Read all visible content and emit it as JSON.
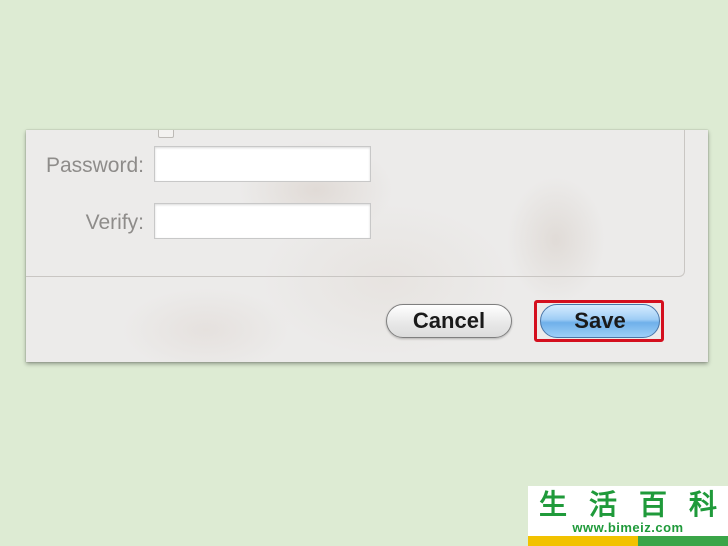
{
  "dialog": {
    "password_label": "Password:",
    "verify_label": "Verify:",
    "password_value": "",
    "verify_value": "",
    "cancel_label": "Cancel",
    "save_label": "Save"
  },
  "watermark": {
    "chars": "生活百科",
    "url": "www.bimeiz.com"
  },
  "colors": {
    "background": "#ddebd3",
    "highlight": "#d40f1e",
    "save_button": "#7fbaee"
  }
}
